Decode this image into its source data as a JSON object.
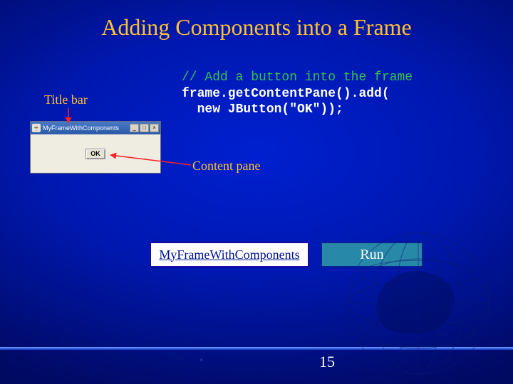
{
  "title": "Adding Components into a Frame",
  "code": {
    "comment": "// Add a button into the frame",
    "line1": "frame.getContentPane().add(",
    "line2": "  new JButton(\"OK\"));"
  },
  "annotations": {
    "title_bar": "Title bar",
    "content_pane": "Content pane"
  },
  "jwindow": {
    "title": "MyFrameWithComponents",
    "icon_glyph": "☕",
    "ctrl_min": "_",
    "ctrl_max": "□",
    "ctrl_close": "×",
    "button_label": "OK"
  },
  "boxes": {
    "classname": "MyFrameWithComponents",
    "run": "Run"
  },
  "footer": {
    "page": "15",
    "mark": "*"
  }
}
